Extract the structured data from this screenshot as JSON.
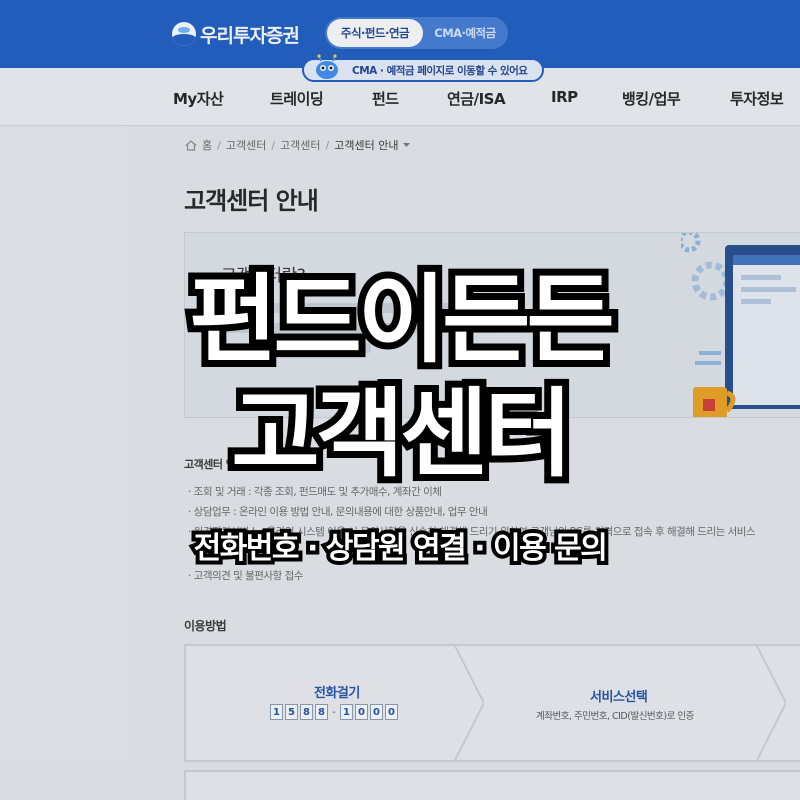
{
  "header": {
    "logo_text": "우리투자증권",
    "segment": {
      "active": "주식·펀드·연금",
      "inactive": "CMA·예적금"
    },
    "tooltip": "CMA · 예적금 페이지로 이동할 수 있어요"
  },
  "nav": {
    "items": [
      "My자산",
      "트레이딩",
      "펀드",
      "연금/ISA",
      "IRP",
      "뱅킹/업무",
      "투자정보"
    ]
  },
  "breadcrumb": {
    "home": "홈",
    "items": [
      "고객센터",
      "고객센터",
      "고객센터 안내"
    ]
  },
  "page_title": "고객센터 안내",
  "info_box": {
    "title": "고객센터란?"
  },
  "work": {
    "title": "고객센터 업무",
    "lines": [
      "· 조회 및 거래 : 각종 조회, 펀드매도 및 추가매수, 계좌간 이체",
      "· 상담업무 : 온라인 이용 방법 안내, 문의내용에 대한 상품안내, 업무 안내",
      "· 원격지원서비스 : 온라인 시스템 이용 시 문의사항을 신속히 해결해 드리기 위하여 고객님의 PC를 원격으로 접속 후 해결해 드리는 서비스",
      "· 고객의견 및 불편사항 접수"
    ]
  },
  "usage": {
    "title": "이용방법",
    "steps": [
      {
        "title": "전화걸기",
        "digits": [
          "1",
          "5",
          "8",
          "8",
          "-",
          "1",
          "0",
          "0",
          "0"
        ]
      },
      {
        "title": "서비스선택",
        "desc": "계좌번호, 주민번호, CID(발신번호)로 인증"
      }
    ]
  },
  "overlay": {
    "line1": "펀드이든든",
    "line2": "고객센터",
    "subtitle": "전화번호 · 상담원 연결 · 이용 문의"
  },
  "colors": {
    "header_blue": "#1a5bc4",
    "step_title_blue": "#1d50a8",
    "page_bg": "#e9ecef"
  }
}
